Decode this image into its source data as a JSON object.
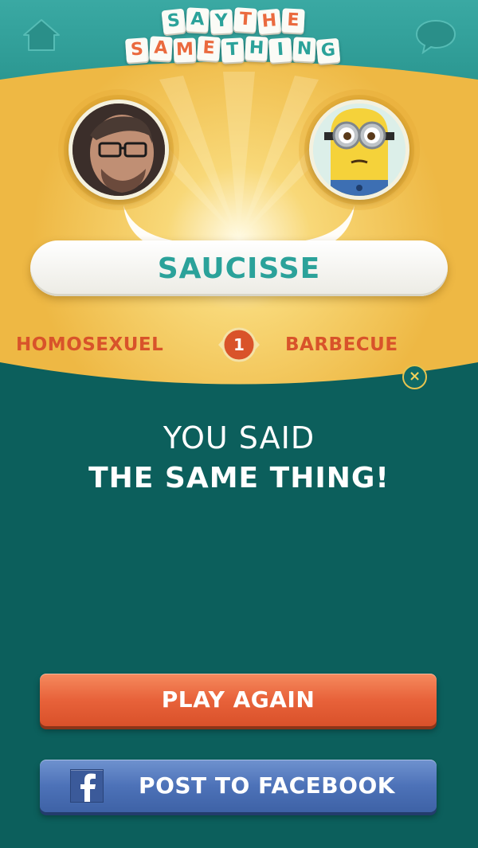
{
  "header": {
    "logo_line1": [
      "S",
      "A",
      "Y",
      "T",
      "H",
      "E"
    ],
    "logo_line2": [
      "S",
      "A",
      "M",
      "E",
      "T",
      "H",
      "I",
      "N",
      "G"
    ],
    "home_icon": "home-icon",
    "chat_icon": "chat-bubble-icon"
  },
  "players": {
    "left_avatar": "player-photo",
    "right_avatar": "minion-avatar"
  },
  "word": "SAUCISSE",
  "guesses": {
    "left": "HOMOSEXUEL",
    "right": "BARBECUE",
    "round": "1"
  },
  "close_icon": "close-icon",
  "result": {
    "line1": "YOU SAID",
    "line2": "THE SAME THING!"
  },
  "buttons": {
    "play_again": "PLAY AGAIN",
    "post_facebook": "POST TO FACEBOOK"
  },
  "colors": {
    "teal": "#2ba29a",
    "gold": "#f2c453",
    "orange": "#e8623a",
    "facebook": "#4d72b8",
    "dark_teal": "#0c5f5c"
  }
}
